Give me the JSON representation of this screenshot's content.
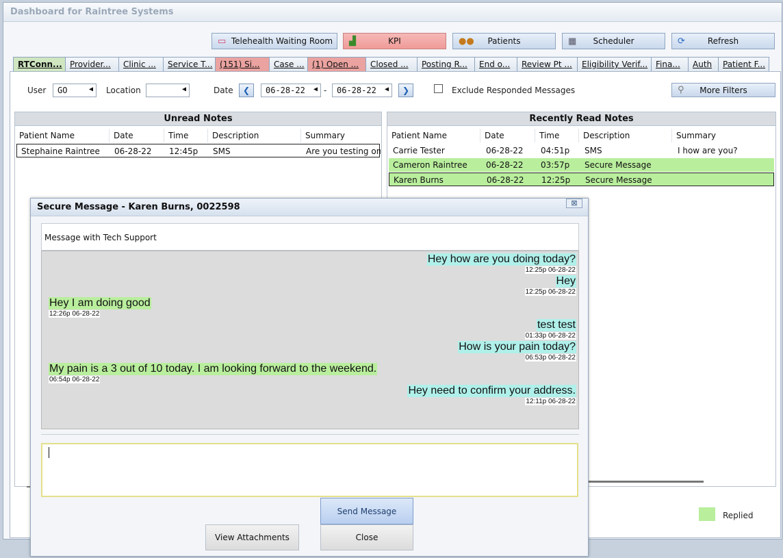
{
  "window": {
    "title": "Dashboard for Raintree Systems"
  },
  "toolbar": {
    "telehealth": "Telehealth Waiting Room",
    "kpi": "KPI",
    "patients": "Patients",
    "scheduler": "Scheduler",
    "refresh": "Refresh"
  },
  "tabs": [
    "RTConn...",
    "Provider...",
    "Clinic ...",
    "Service T...",
    "(151) Si...",
    "Case ...",
    "(1) Open ...",
    "Closed ...",
    "Posting R...",
    "End o...",
    "Review Pt ...",
    "Eligibility Verif...",
    "Fina...",
    "Auth",
    "Patient F..."
  ],
  "filters": {
    "user_label": "User",
    "user_value": "GO",
    "location_label": "Location",
    "location_value": "",
    "date_label": "Date",
    "date_from": "06-28-22",
    "date_sep": "-",
    "date_to": "06-28-22",
    "exclude_label": "Exclude Responded Messages",
    "more_filters": "More Filters"
  },
  "unread": {
    "title": "Unread Notes",
    "columns": [
      "Patient Name",
      "Date",
      "Time",
      "Description",
      "Summary"
    ],
    "rows": [
      [
        "Stephaine Raintree",
        "06-28-22",
        "12:45p",
        "SMS",
        "Are you testing on"
      ]
    ]
  },
  "recent": {
    "title": "Recently Read Notes",
    "columns": [
      "Patient Name",
      "Date",
      "Time",
      "Description",
      "Summary"
    ],
    "rows": [
      [
        "Carrie Tester",
        "06-28-22",
        "04:51p",
        "SMS",
        "I how are you?"
      ],
      [
        "Cameron Raintree",
        "06-28-22",
        "03:57p",
        "Secure Message",
        ""
      ],
      [
        "Karen Burns",
        "06-28-22",
        "12:25p",
        "Secure Message",
        ""
      ]
    ]
  },
  "legend": {
    "replied": "Replied",
    "replied_color": "#b9ee9d"
  },
  "dialog": {
    "title": "Secure Message - Karen Burns, 0022598",
    "close_glyph": "⊠",
    "subject": "Message with Tech Support",
    "messages": [
      {
        "text": "Hey how are you doing today?",
        "time": "12:25p 06-28-22",
        "side": "sent"
      },
      {
        "text": "Hey",
        "time": "12:25p 06-28-22",
        "side": "sent"
      },
      {
        "text": "Hey I am doing good",
        "time": "12:26p 06-28-22",
        "side": "received"
      },
      {
        "text": "test test",
        "time": "01:33p 06-28-22",
        "side": "sent"
      },
      {
        "text": "How is your pain today?",
        "time": "06:53p 06-28-22",
        "side": "sent"
      },
      {
        "text": "My pain is a 3 out of 10 today. I am looking forward to the weekend.",
        "time": "06:54p 06-28-22",
        "side": "received"
      },
      {
        "text": "Hey need to confirm your address.",
        "time": "12:11p 06-28-22",
        "side": "sent"
      }
    ],
    "input_value": "",
    "send": "Send Message",
    "view_attachments": "View Attachments",
    "close": "Close"
  }
}
